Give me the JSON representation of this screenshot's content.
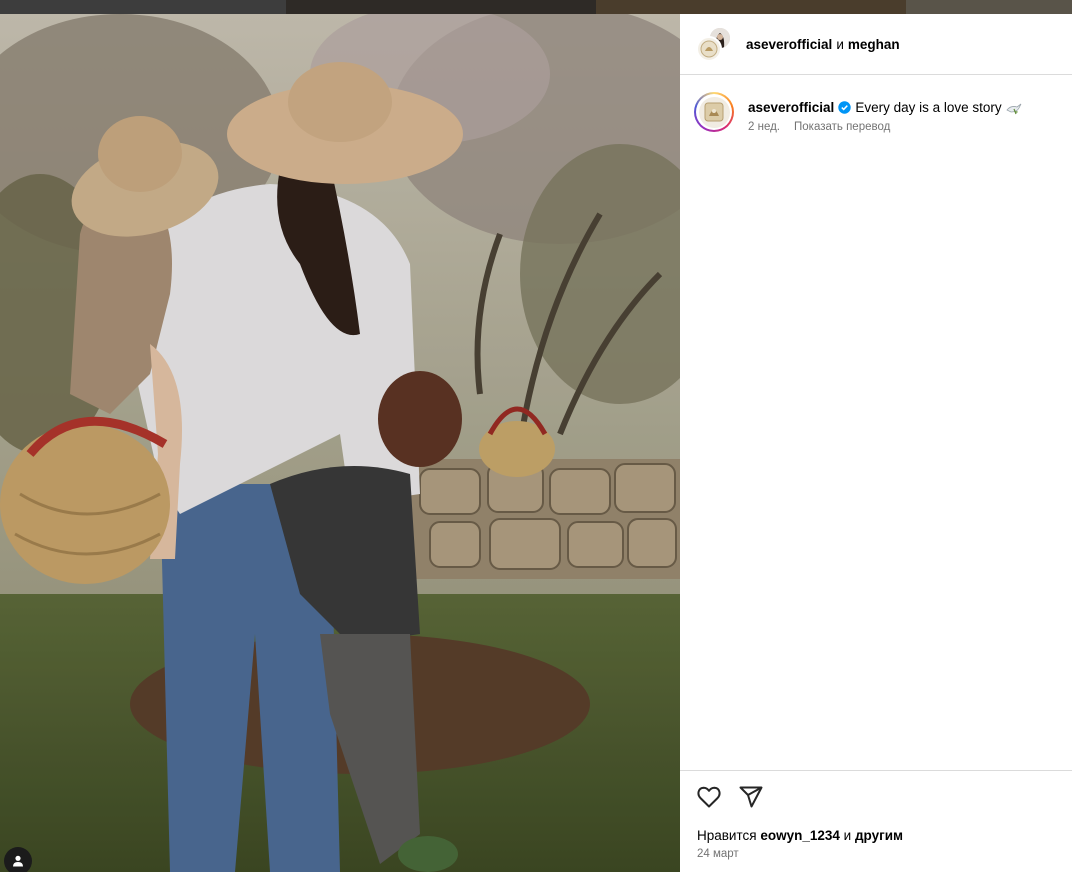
{
  "header": {
    "user1": "aseverofficial",
    "conjunction": "и",
    "user2": "meghan"
  },
  "caption": {
    "username": "aseverofficial",
    "text": "Every day is a love story",
    "emoji": "dove-olive-branch",
    "age": "2 нед.",
    "translate_label": "Показать перевод"
  },
  "likes": {
    "prefix": "Нравится",
    "user": "eowyn_1234",
    "conjunction": "и",
    "others": "другим"
  },
  "date": "24 март",
  "icons": {
    "like": "heart-icon",
    "share": "paper-plane-icon",
    "verified": "verified-badge-icon",
    "user_tag": "person-icon"
  },
  "colors": {
    "verified_blue": "#0095f6",
    "meta_gray": "#737373",
    "divider": "#dbdbdb"
  }
}
